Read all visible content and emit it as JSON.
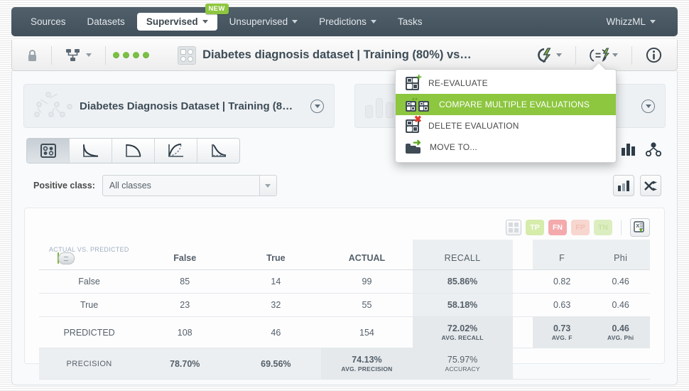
{
  "navbar": {
    "items": [
      {
        "label": "Sources",
        "icon": null,
        "active": false,
        "caret": false,
        "badge": null
      },
      {
        "label": "Datasets",
        "icon": null,
        "active": false,
        "caret": false,
        "badge": null
      },
      {
        "label": "Supervised",
        "icon": null,
        "active": true,
        "caret": true,
        "badge": "NEW"
      },
      {
        "label": "Unsupervised",
        "icon": null,
        "active": false,
        "caret": true,
        "badge": null
      },
      {
        "label": "Predictions",
        "icon": null,
        "active": false,
        "caret": true,
        "badge": null
      },
      {
        "label": "Tasks",
        "icon": null,
        "active": false,
        "caret": false,
        "badge": null
      }
    ],
    "account": "WhizzML"
  },
  "resource_header": {
    "lock_icon": "lock-icon",
    "project_icon": "project-tree-icon",
    "status_dots": 4,
    "status_dot_color": "#7ac043",
    "title": "Diabetes diagnosis dataset | Training (80%) vs…",
    "title_icon": "evaluation-icon",
    "actions": [
      {
        "name": "actions-menu-icon",
        "glyph": "℘"
      },
      {
        "name": "scripts-menu-icon",
        "glyph": "(=)"
      },
      {
        "name": "info-icon",
        "glyph": "i"
      }
    ]
  },
  "menu": {
    "items": [
      {
        "label": "RE-EVALUATE",
        "icon": "evaluate-add-icon",
        "selected": false
      },
      {
        "label": "COMPARE MULTIPLE EVALUATIONS",
        "icon": "compare-evaluations-icon",
        "selected": true
      },
      {
        "label": "DELETE EVALUATION",
        "icon": "evaluate-delete-icon",
        "selected": false
      },
      {
        "label": "MOVE TO...",
        "icon": "move-folder-icon",
        "selected": false
      }
    ],
    "highlight_color": "#8dc63f"
  },
  "cards": [
    {
      "icon": "model-tree-icon",
      "title": "Diabetes Diagnosis Dataset | Training (8…",
      "caret": "caret-down-icon"
    },
    {
      "icon": "dataset-bars-icon",
      "title": "",
      "caret": "caret-down-icon"
    }
  ],
  "chart_tabs": [
    {
      "name": "tab-confusion-matrix",
      "icon": "confusion-matrix-icon",
      "active": true
    },
    {
      "name": "tab-roc-curve",
      "icon": "roc-curve-icon",
      "active": false
    },
    {
      "name": "tab-precision-recall-curve",
      "icon": "pr-curve-icon",
      "active": false
    },
    {
      "name": "tab-gain-curve",
      "icon": "gain-curve-icon",
      "active": false
    },
    {
      "name": "tab-ks-curve",
      "icon": "ks-curve-icon",
      "active": false
    }
  ],
  "tabs_right_icons": [
    {
      "name": "histogram-icon"
    },
    {
      "name": "model-node-icon"
    }
  ],
  "positive_class": {
    "label": "Positive class:",
    "value": "All classes",
    "placeholder": "All classes"
  },
  "positive_class_actions": [
    {
      "name": "chart-toggle-button",
      "icon": "bar-chart-icon"
    },
    {
      "name": "swap-axes-button",
      "icon": "shuffle-icon"
    }
  ],
  "table_toolbar": {
    "grid_toggle": "grid-icon",
    "pills": [
      {
        "label": "TP",
        "name": "pill-true-positive"
      },
      {
        "label": "FN",
        "name": "pill-false-negative"
      },
      {
        "label": "FP",
        "name": "pill-false-positive"
      },
      {
        "label": "TN",
        "name": "pill-true-negative"
      }
    ],
    "export": "export-excel-icon"
  },
  "chart_data": {
    "type": "table",
    "title": "Confusion matrix",
    "corner_label": "ACTUAL VS. PREDICTED",
    "toggle_on": true,
    "columns": [
      "",
      "False",
      "True",
      "ACTUAL",
      "RECALL"
    ],
    "extra_columns": [
      "F",
      "Phi"
    ],
    "rows": [
      {
        "label": "False",
        "cells": [
          "85",
          "14"
        ],
        "actual": "99",
        "recall": "85.86%",
        "f": "0.82",
        "phi": "0.46"
      },
      {
        "label": "True",
        "cells": [
          "23",
          "32"
        ],
        "actual": "55",
        "recall": "58.18%",
        "f": "0.63",
        "phi": "0.46"
      },
      {
        "label": "PREDICTED",
        "cells": [
          "108",
          "46"
        ],
        "actual": "154",
        "recall": "72.02%",
        "recall_sub": "AVG. RECALL",
        "f": "0.73",
        "f_sub": "AVG. F",
        "phi": "0.46",
        "phi_sub": "AVG. Phi"
      },
      {
        "label": "PRECISION",
        "cells": [
          "78.70%",
          "69.56%"
        ],
        "actual": "74.13%",
        "actual_sub": "AVG. PRECISION",
        "recall": "75.97%",
        "recall_sub": "ACCURACY",
        "f": "",
        "phi": ""
      }
    ],
    "confusion_matrix": {
      "classes": [
        "False",
        "True"
      ],
      "matrix": [
        [
          85,
          14
        ],
        [
          23,
          32
        ]
      ],
      "actual_totals": [
        99,
        55
      ],
      "predicted_totals": [
        108,
        46
      ],
      "grand_total": 154,
      "recall": [
        0.8586,
        0.5818
      ],
      "precision": [
        0.787,
        0.6956
      ],
      "f_measure": [
        0.82,
        0.63
      ],
      "phi": [
        0.46,
        0.46
      ],
      "avg_recall": 0.7202,
      "avg_precision": 0.7413,
      "avg_f": 0.73,
      "avg_phi": 0.46,
      "accuracy": 0.7597
    }
  }
}
